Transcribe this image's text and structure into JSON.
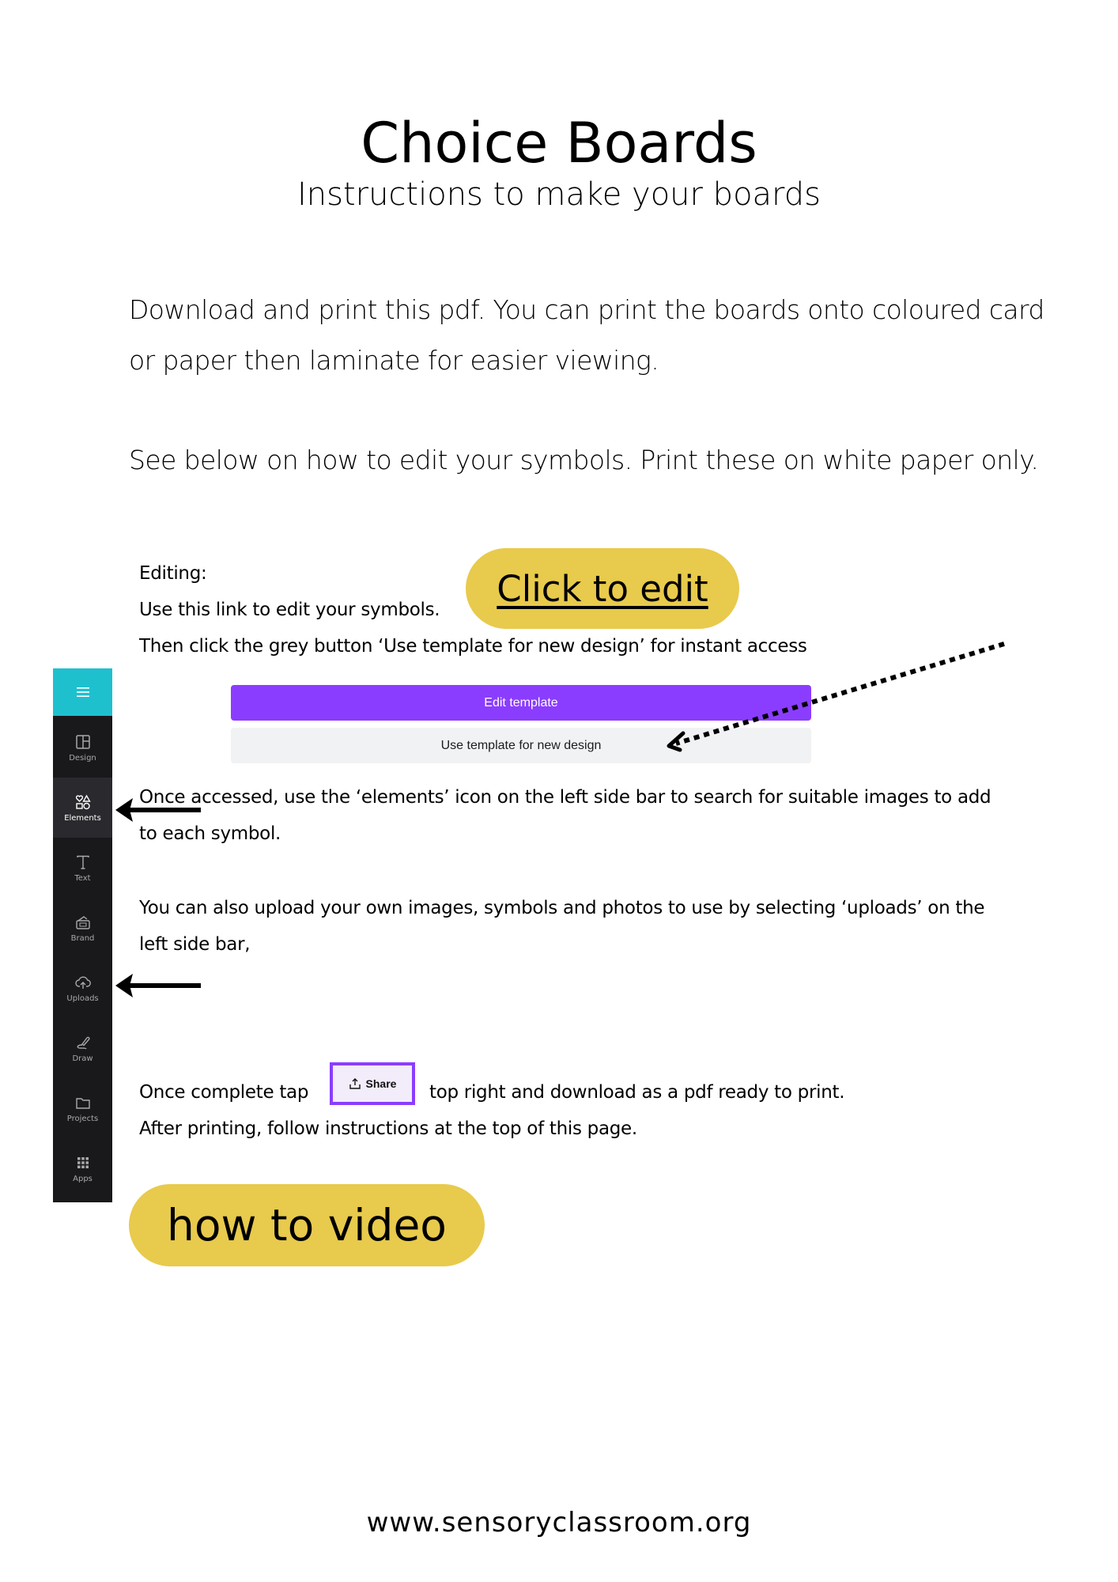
{
  "header": {
    "title": "Choice Boards",
    "subtitle": "Instructions to make your boards"
  },
  "intro": {
    "line1": "Download and print this pdf. You can print the boards onto coloured card",
    "line2": "or paper then laminate for easier viewing.",
    "line3": "See below on how to edit your symbols. Print these on white paper only."
  },
  "editing": {
    "heading": "Editing:",
    "link_text": "Use this link to edit your symbols.",
    "instruction": "Then click the grey button ‘Use template for new design’ for instant access",
    "click_to_edit_label": "Click to edit"
  },
  "template_buttons": {
    "edit_template": "Edit template",
    "use_template": "Use template for new design"
  },
  "sidebar": {
    "menu_icon": "hamburger-icon",
    "items": [
      {
        "label": "Design",
        "icon": "layout-icon"
      },
      {
        "label": "Elements",
        "icon": "shapes-icon",
        "active": true
      },
      {
        "label": "Text",
        "icon": "text-icon"
      },
      {
        "label": "Brand",
        "icon": "brand-icon"
      },
      {
        "label": "Uploads",
        "icon": "cloud-upload-icon"
      },
      {
        "label": "Draw",
        "icon": "pen-icon"
      },
      {
        "label": "Projects",
        "icon": "folder-icon"
      },
      {
        "label": "Apps",
        "icon": "grid-icon"
      }
    ],
    "colors": {
      "top": "#1fc0ce",
      "background": "#19191b"
    }
  },
  "steps": {
    "elements_line1": "Once accessed,  use the ‘elements’ icon on the left side bar to search for suitable images to add",
    "elements_line2": "to each symbol.",
    "uploads_line1": "You can also upload your own images, symbols and photos to use by selecting ‘uploads’ on the",
    "uploads_line2": "left side bar,",
    "complete_before": "Once complete tap",
    "complete_after": "top right and download as a pdf ready to print.",
    "after_printing": "After printing, follow instructions at the top of this page.",
    "share_label": "Share"
  },
  "video": {
    "label": "how to video"
  },
  "footer": {
    "url": "www.sensoryclassroom.org"
  },
  "colors": {
    "pill": "#e8ca4c",
    "purple": "#8b3dff",
    "grey_button": "#f1f2f4"
  }
}
